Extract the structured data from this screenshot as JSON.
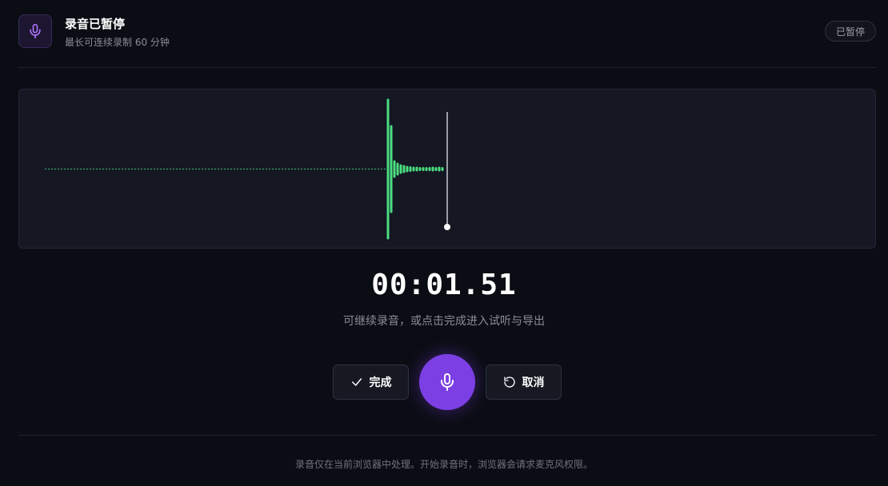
{
  "header": {
    "title": "录音已暂停",
    "subtitle": "最长可连续录制 60 分钟",
    "status": "已暂停",
    "icon": "microphone-icon"
  },
  "recording": {
    "time": "00:01.51",
    "hint": "可继续录音，或点击完成进入试听与导出"
  },
  "controls": {
    "done_label": "完成",
    "done_icon": "check-icon",
    "record_icon": "microphone-icon",
    "cancel_label": "取消",
    "cancel_icon": "rotate-ccw-icon"
  },
  "footer": {
    "note": "录音仅在当前浏览器中处理。开始录音时，浏览器会请求麦克风权限。"
  },
  "colors": {
    "background": "#0b0d14",
    "accent": "#7c3fe4",
    "wave": "#4ade80",
    "playhead": "#ffffff"
  }
}
